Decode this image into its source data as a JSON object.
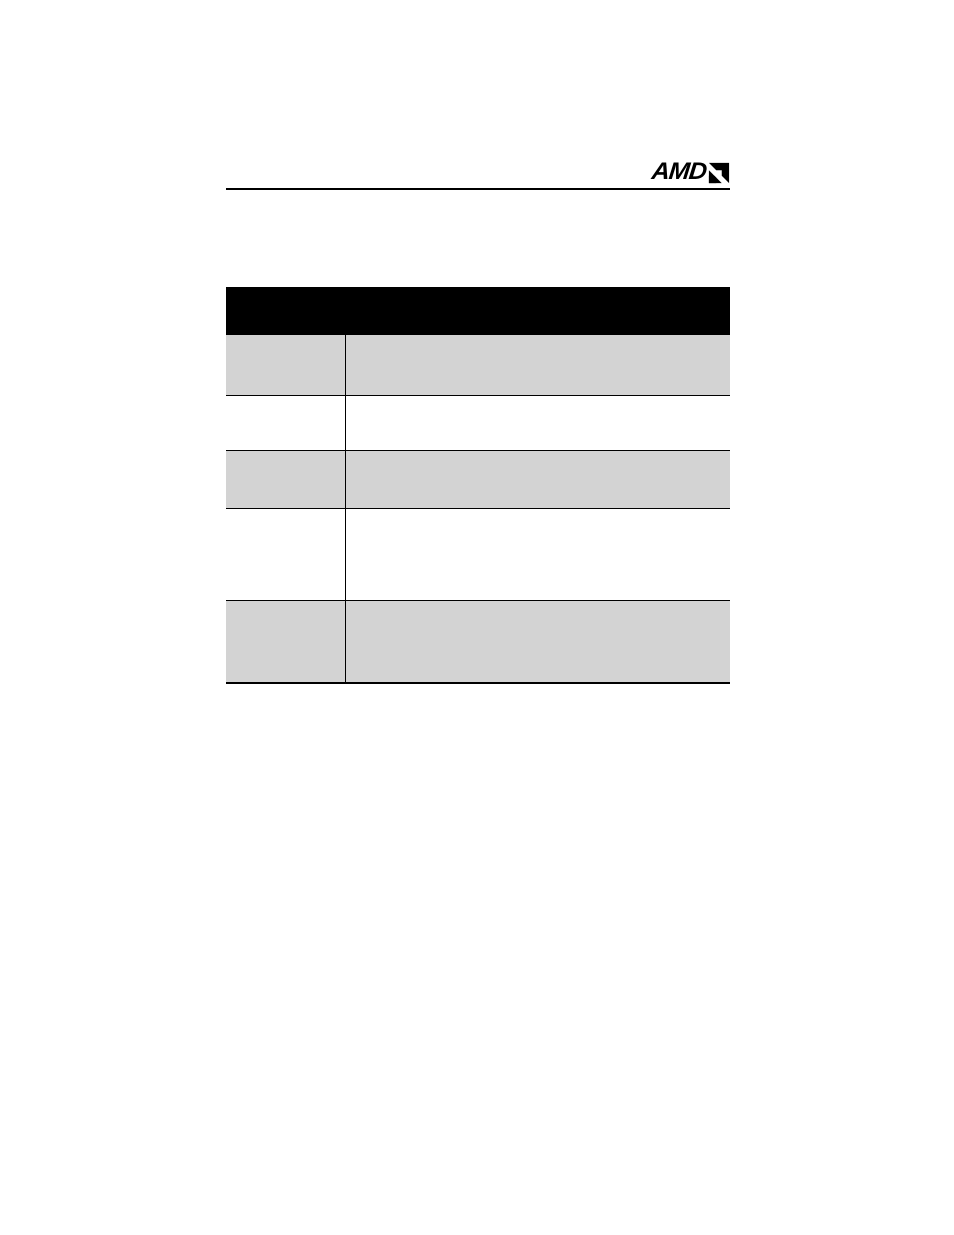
{
  "brand": {
    "logo_text": "AMD"
  },
  "table": {
    "header": {
      "c1": "",
      "c2": ""
    },
    "rows": [
      {
        "c1": "",
        "c2": ""
      },
      {
        "c1": "",
        "c2": ""
      },
      {
        "c1": "",
        "c2": ""
      },
      {
        "c1": "",
        "c2": ""
      },
      {
        "c1": "",
        "c2": ""
      }
    ]
  }
}
